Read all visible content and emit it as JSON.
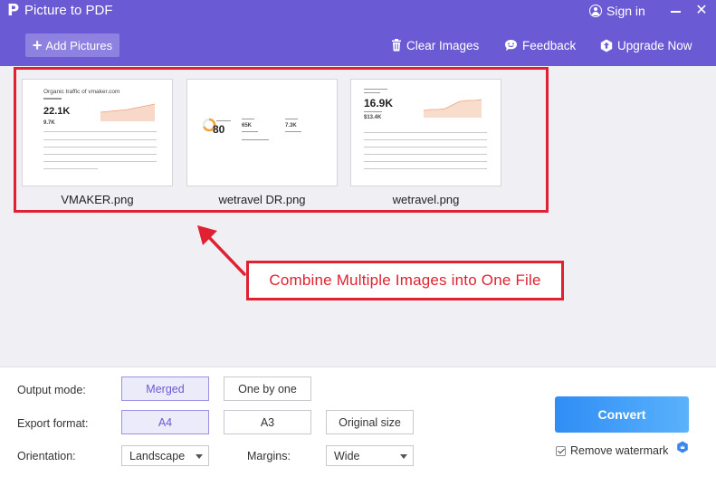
{
  "app": {
    "title": "Picture to PDF",
    "logo_glyph": "P",
    "sign_in": "Sign in",
    "minimize_icon": "minimize-icon",
    "close_glyph": "✕"
  },
  "toolbar": {
    "add_pictures": "Add Pictures",
    "add_glyph": "+",
    "clear_images": "Clear Images",
    "feedback": "Feedback",
    "upgrade_now": "Upgrade Now"
  },
  "images": [
    {
      "name": "VMAKER.png",
      "preview": {
        "heading": "Organic traffic of vmaker.com",
        "value_1": "22.1K",
        "value_2": "9.7K"
      }
    },
    {
      "name": "wetravel DR.png",
      "preview": {
        "score": "80",
        "value_1": "65K",
        "value_2": "7.3K"
      }
    },
    {
      "name": "wetravel.png",
      "preview": {
        "value_1": "16.9K",
        "value_2": "$13.4K"
      }
    }
  ],
  "annotation": {
    "callout": "Combine Multiple Images into One File"
  },
  "options": {
    "output_mode": {
      "label": "Output mode:",
      "choices": [
        "Merged",
        "One by one"
      ],
      "selected": "Merged"
    },
    "export_format": {
      "label": "Export format:",
      "choices": [
        "A4",
        "A3",
        "Original size"
      ],
      "selected": "A4"
    },
    "orientation": {
      "label": "Orientation:",
      "value": "Landscape"
    },
    "margins": {
      "label": "Margins:",
      "value": "Wide"
    }
  },
  "convert": {
    "label": "Convert",
    "remove_watermark": "Remove watermark",
    "remove_watermark_checked": true
  },
  "colors": {
    "header": "#6a5ad3",
    "annotation_red": "#e02131",
    "convert_blue": "#2f8df5"
  }
}
